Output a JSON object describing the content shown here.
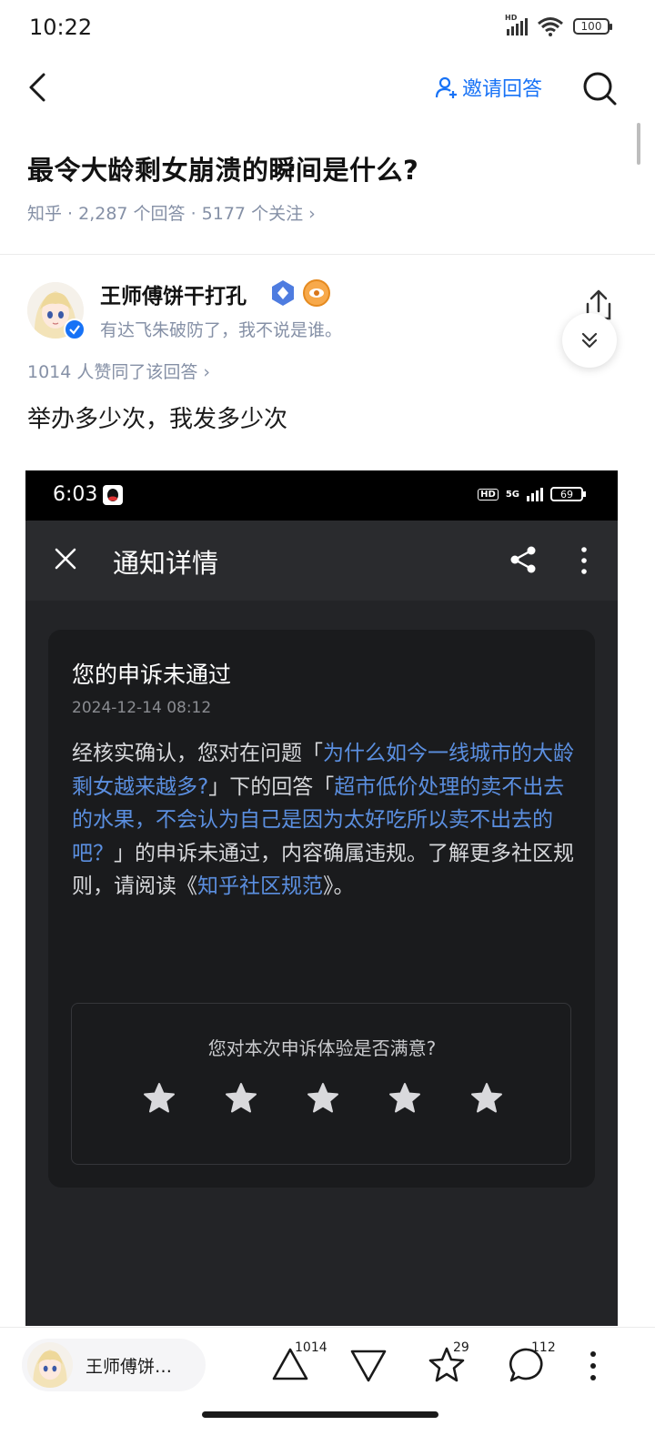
{
  "status_bar": {
    "time": "10:22",
    "battery": "100",
    "network": "HD"
  },
  "nav": {
    "invite_label": "邀请回答"
  },
  "question": {
    "title": "最令大龄剩女崩溃的瞬间是什么?",
    "meta": "知乎 · 2,287 个回答 · 5177 个关注 ›"
  },
  "author": {
    "name": "王师傅饼干打孔",
    "bio": "有达飞朱破防了，我不说是谁。",
    "name_short": "王师傅饼…"
  },
  "answer": {
    "upvote_summary": "1014 人赞同了该回答 ›",
    "text": "举办多少次，我发多少次"
  },
  "embedded": {
    "status_time": "6:03",
    "status_battery": "69",
    "status_hd": "HD",
    "status_5g": "5G",
    "title": "通知详情",
    "notice_title": "您的申诉未通过",
    "notice_date": "2024-12-14 08:12",
    "body": {
      "part1": "经核实确认，您对在问题「",
      "link1": "为什么如今一线城市的大龄剩女越来越多?",
      "part2": "」下的回答「",
      "link2": "超市低价处理的卖不出去的水果，不会认为自己是因为太好吃所以卖不出去的吧？",
      "part3": "」的申诉未通过，内容确属违规。了解更多社区规则，请阅读《",
      "link3": "知乎社区规范",
      "part4": "》。"
    },
    "rating_question": "您对本次申诉体验是否满意?",
    "star_count": 5
  },
  "bottom_bar": {
    "upvote_count": "1014",
    "favorite_count": "29",
    "comment_count": "112"
  },
  "colors": {
    "accent": "#1772f6",
    "link_dark": "#5b8fe0",
    "meta_gray": "#8590a6"
  }
}
